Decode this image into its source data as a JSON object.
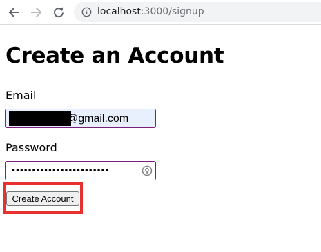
{
  "browser": {
    "url_host": "localhost",
    "url_path": ":3000/signup",
    "icons": {
      "back": "arrow-left-icon",
      "forward": "arrow-right-icon",
      "reload": "reload-icon",
      "site_info": "info-icon"
    }
  },
  "form": {
    "title": "Create an Account",
    "email": {
      "label": "Email",
      "value_visible": "@gmail.com",
      "redacted": true
    },
    "password": {
      "label": "Password",
      "masked_value": "••••••••••••••••••••••••",
      "icon": "password-key-icon"
    },
    "submit": {
      "label": "Create Account"
    }
  },
  "colors": {
    "input_border": "#7b1f7f",
    "autofill_background": "#e8f0fe",
    "highlight": "#e8302f",
    "button_background": "#efefef"
  }
}
